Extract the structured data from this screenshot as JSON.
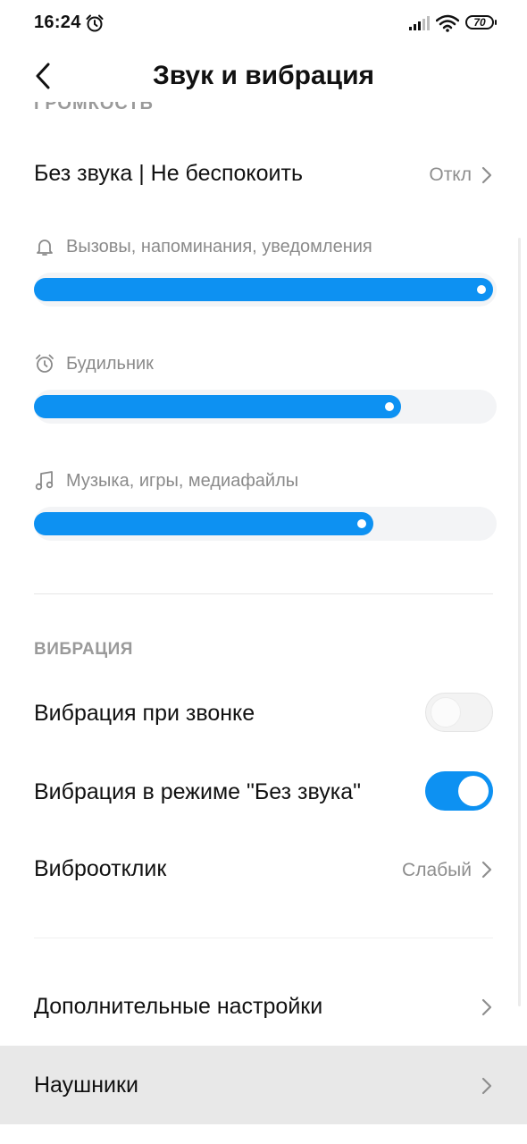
{
  "status_bar": {
    "time": "16:24",
    "battery": "70"
  },
  "header": {
    "title": "Звук и вибрация"
  },
  "peek_section_label": "ГРОМКОСТЬ",
  "silent_mode": {
    "label": "Без звука | Не беспокоить",
    "value": "Откл"
  },
  "volumes": [
    {
      "label": "Вызовы, напоминания, уведомления",
      "icon": "bell-icon",
      "level": 1.0
    },
    {
      "label": "Будильник",
      "icon": "alarm-clock-icon",
      "level": 0.8
    },
    {
      "label": "Музыка, игры, медиафайлы",
      "icon": "music-note-icon",
      "level": 0.74
    }
  ],
  "vibration": {
    "section_title": "ВИБРАЦИЯ",
    "on_ring": {
      "label": "Вибрация при звонке",
      "enabled": false
    },
    "on_silent": {
      "label": "Вибрация в режиме \"Без звука\"",
      "enabled": true
    },
    "haptic": {
      "label": "Виброотклик",
      "value": "Слабый"
    }
  },
  "more": {
    "additional_settings": "Дополнительные настройки",
    "headphones": "Наушники"
  },
  "colors": {
    "accent": "#0d91f2",
    "track": "#f3f4f6",
    "highlight": "#e8e8e8"
  }
}
